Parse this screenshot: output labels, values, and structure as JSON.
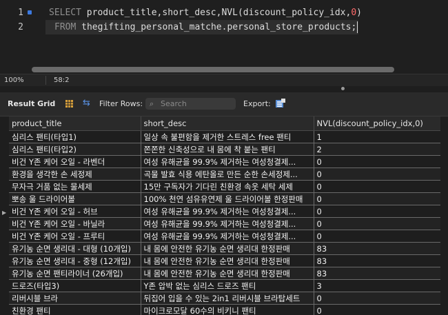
{
  "editor": {
    "lines": [
      {
        "num": "1",
        "kw1": "SELECT",
        "rest1": " product_title,short_desc,NVL(discount_policy_idx,",
        "numlit": "0",
        "rest2": ")"
      },
      {
        "num": "2",
        "kw1": "FROM",
        "rest1": " thegifting_personal_matche.personal_store_products;"
      }
    ]
  },
  "status": {
    "zoom": "100%",
    "cursor_pos": "58:2"
  },
  "toolbar": {
    "title": "Result Grid",
    "filter_label": "Filter Rows:",
    "search_placeholder": "Search",
    "export_label": "Export:",
    "icons": [
      "grid-icon",
      "refresh-icon",
      "search-icon",
      "export-icon"
    ]
  },
  "grid": {
    "columns": [
      "product_title",
      "short_desc",
      "NVL(discount_policy_idx,0)"
    ],
    "rows": [
      [
        "심리스 팬티(타입1)",
        "일상 속 불편함을 제거한 스트레스 free 팬티",
        "1"
      ],
      [
        "심리스 팬티(타입2)",
        "쫀쫀한 신축성으로 내 몸에 착 붙는 팬티",
        "2"
      ],
      [
        "비건 Y존 케어 오일 - 라벤더",
        "여성 유해균을 99.9% 제거하는 여성청결제...",
        "0"
      ],
      [
        "환경을 생각한 손 세정제",
        "곡물 발효 식용 에탄올로 만든 순한 손세정제...",
        "0"
      ],
      [
        "무자극 거품 없는 물세제",
        "15만 구독자가 기다린 친환경 속옷 세탁 세제",
        "0"
      ],
      [
        "뽀송 울 드라이어볼",
        "100% 천연 섬유유연제 울 드라이어볼 한정판매",
        "0"
      ],
      [
        "비건 Y존 케어 오일 - 허브",
        "여성 유해균을 99.9% 제거하는 여성청결제...",
        "0"
      ],
      [
        "비건 Y존 케어 오일 - 바닐라",
        "여성 유해균을 99.9% 제거하는 여성청결제...",
        "0"
      ],
      [
        "비건 Y존 케어 오일 - 프루티",
        "여성 유해균을 99.9% 제거하는 여성청결제...",
        "0"
      ],
      [
        "유기농 순면 생리대 - 대형 (10개입)",
        "내 몸에 안전한 유기농 순면 생리대 한정판매",
        "83"
      ],
      [
        "유기농 순면 생리대 - 중형 (12개입)",
        "내 몸에 안전한 유기농 순면 생리대 한정판매",
        "83"
      ],
      [
        "유기농 순면 팬티라이너 (26개입)",
        "내 몸에 안전한 유기농 순면 생리대 한정판매",
        "83"
      ],
      [
        "드로즈(타입3)",
        "Y존 압박 없는 심리스 드로즈 팬티",
        "3"
      ],
      [
        "리버시블 브라",
        "뒤집어 입을 수 있는 2in1 리버시블 브라탑세트",
        "0"
      ],
      [
        "친환경 팬티",
        "마이크로모달 60수의 비키니 팬티",
        "0"
      ]
    ],
    "selected_row_indicator": "▶"
  },
  "colors": {
    "accent": "#3d7ae0",
    "keyword": "#8f8f8f",
    "number": "#ff6a6a"
  }
}
